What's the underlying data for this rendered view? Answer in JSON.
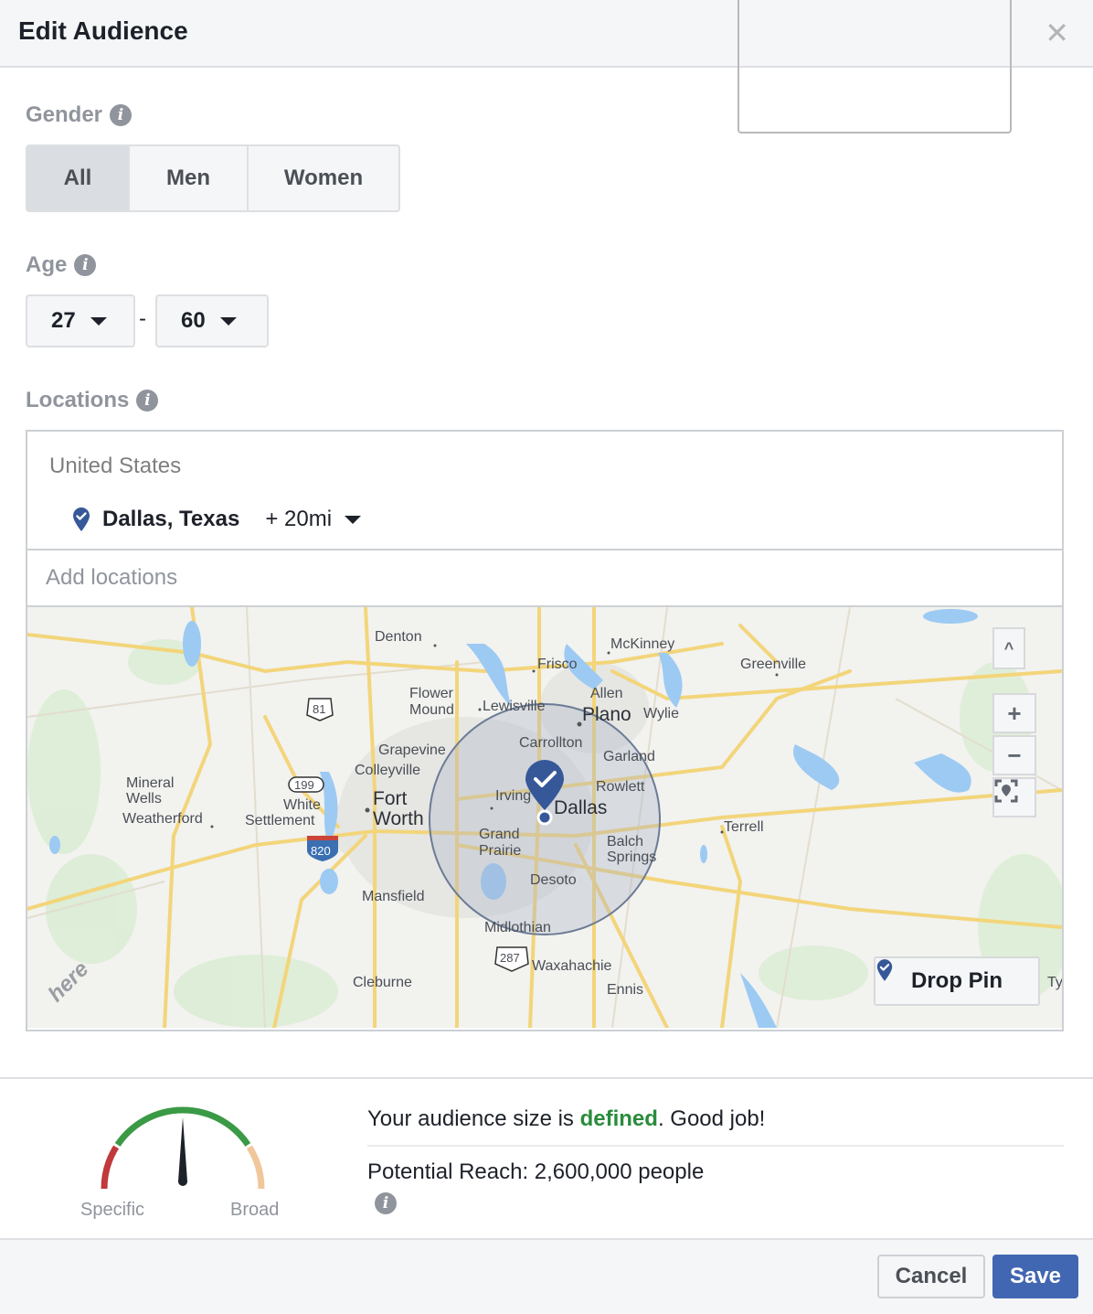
{
  "dialog": {
    "title": "Edit Audience",
    "close_icon": "close-icon"
  },
  "gender": {
    "label": "Gender",
    "info_icon": "info-icon",
    "options": [
      "All",
      "Men",
      "Women"
    ],
    "selected": "All"
  },
  "age": {
    "label": "Age",
    "info_icon": "info-icon",
    "min": "27",
    "separator": "-",
    "max": "60"
  },
  "locations": {
    "label": "Locations",
    "info_icon": "info-icon",
    "country": "United States",
    "selected_location": "Dallas, Texas",
    "radius": "+ 20mi",
    "add_placeholder": "Add locations",
    "map": {
      "cities": {
        "denton": "Denton",
        "mckinney": "McKinney",
        "frisco": "Frisco",
        "greenville": "Greenville",
        "flower_mound_1": "Flower",
        "flower_mound_2": "Mound",
        "lewisville": "Lewisville",
        "allen": "Allen",
        "plano": "Plano",
        "wylie": "Wylie",
        "grapevine": "Grapevine",
        "carrollton": "Carrollton",
        "colleyville": "Colleyville",
        "garland": "Garland",
        "mineral_wells_1": "Mineral",
        "mineral_wells_2": "Wells",
        "fort_worth_1": "Fort",
        "fort_worth_2": "Worth",
        "irving": "Irving",
        "rowlett": "Rowlett",
        "dallas": "Dallas",
        "white_settlement_1": "White",
        "white_settlement_2": "Settlement",
        "weatherford": "Weatherford",
        "grand_prairie_1": "Grand",
        "grand_prairie_2": "Prairie",
        "balch_springs_1": "Balch",
        "balch_springs_2": "Springs",
        "terrell": "Terrell",
        "desoto": "Desoto",
        "mansfield": "Mansfield",
        "midlothian": "Midlothian",
        "waxahachie": "Waxahachie",
        "cleburne": "Cleburne",
        "ennis": "Ennis",
        "tyler_partial": "Ty"
      },
      "highway_shields": [
        "81",
        "199",
        "820",
        "287"
      ],
      "controls": {
        "collapse": "^",
        "zoom_in": "+",
        "zoom_out": "−"
      },
      "drop_pin_label": "Drop Pin",
      "attribution": "here"
    }
  },
  "colors": {
    "brand_blue": "#4267b2",
    "pin_blue": "#365899",
    "good_green": "#2a8b3c",
    "gauge_red": "#c0393b",
    "gauge_green": "#3b9a45",
    "gauge_peach": "#f0c69a"
  },
  "audience_meter": {
    "specific_label": "Specific",
    "broad_label": "Broad",
    "position_fraction": 0.5,
    "status_prefix": "Your audience size is ",
    "status_word": "defined",
    "status_suffix": ". Good job!",
    "potential_reach": "Potential Reach: 2,600,000 people"
  },
  "footer": {
    "cancel_label": "Cancel",
    "save_label": "Save"
  }
}
